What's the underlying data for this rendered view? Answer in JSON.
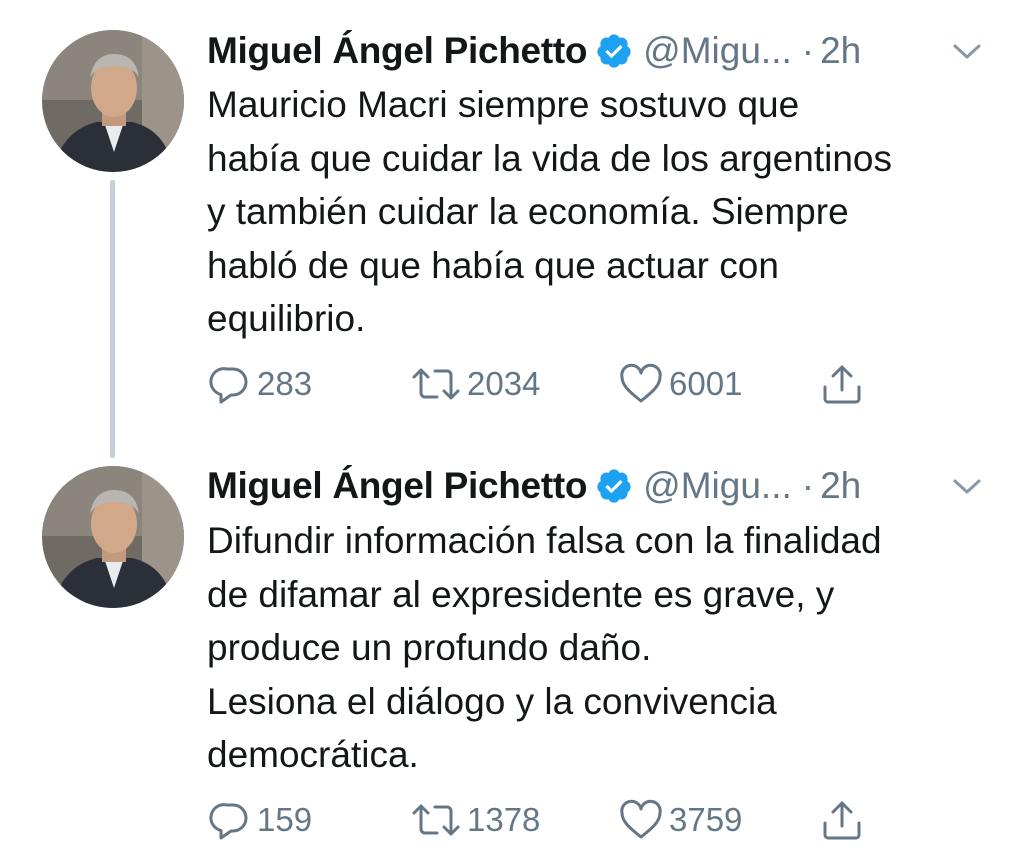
{
  "thread": [
    {
      "author": {
        "display_name": "Miguel Ángel Pichetto",
        "verified": true,
        "handle": "@Migu...",
        "separator": "·",
        "time": "2h"
      },
      "text": "Mauricio Macri siempre sostuvo que\nhabía que cuidar la vida de los argentinos\ny también cuidar la economía. Siempre\nhabló de que había que actuar con\nequilibrio.",
      "stats": {
        "replies": "283",
        "retweets": "2034",
        "likes": "6001"
      },
      "icons": [
        "reply-icon",
        "retweet-icon",
        "like-icon",
        "share-icon",
        "chevron-down-icon",
        "verified-badge-icon"
      ]
    },
    {
      "author": {
        "display_name": "Miguel Ángel Pichetto",
        "verified": true,
        "handle": "@Migu...",
        "separator": "·",
        "time": "2h"
      },
      "text": "Difundir información falsa con la finalidad\nde difamar al  expresidente es grave, y\nproduce un profundo daño.\nLesiona el diálogo y la convivencia\ndemocrática.",
      "stats": {
        "replies": "159",
        "retweets": "1378",
        "likes": "3759"
      },
      "icons": [
        "reply-icon",
        "retweet-icon",
        "like-icon",
        "share-icon",
        "chevron-down-icon",
        "verified-badge-icon"
      ]
    }
  ],
  "colors": {
    "text": "#14171a",
    "secondary": "#657786",
    "verified_blue": "#1da1f2",
    "thread_line": "#c4cfd6"
  }
}
